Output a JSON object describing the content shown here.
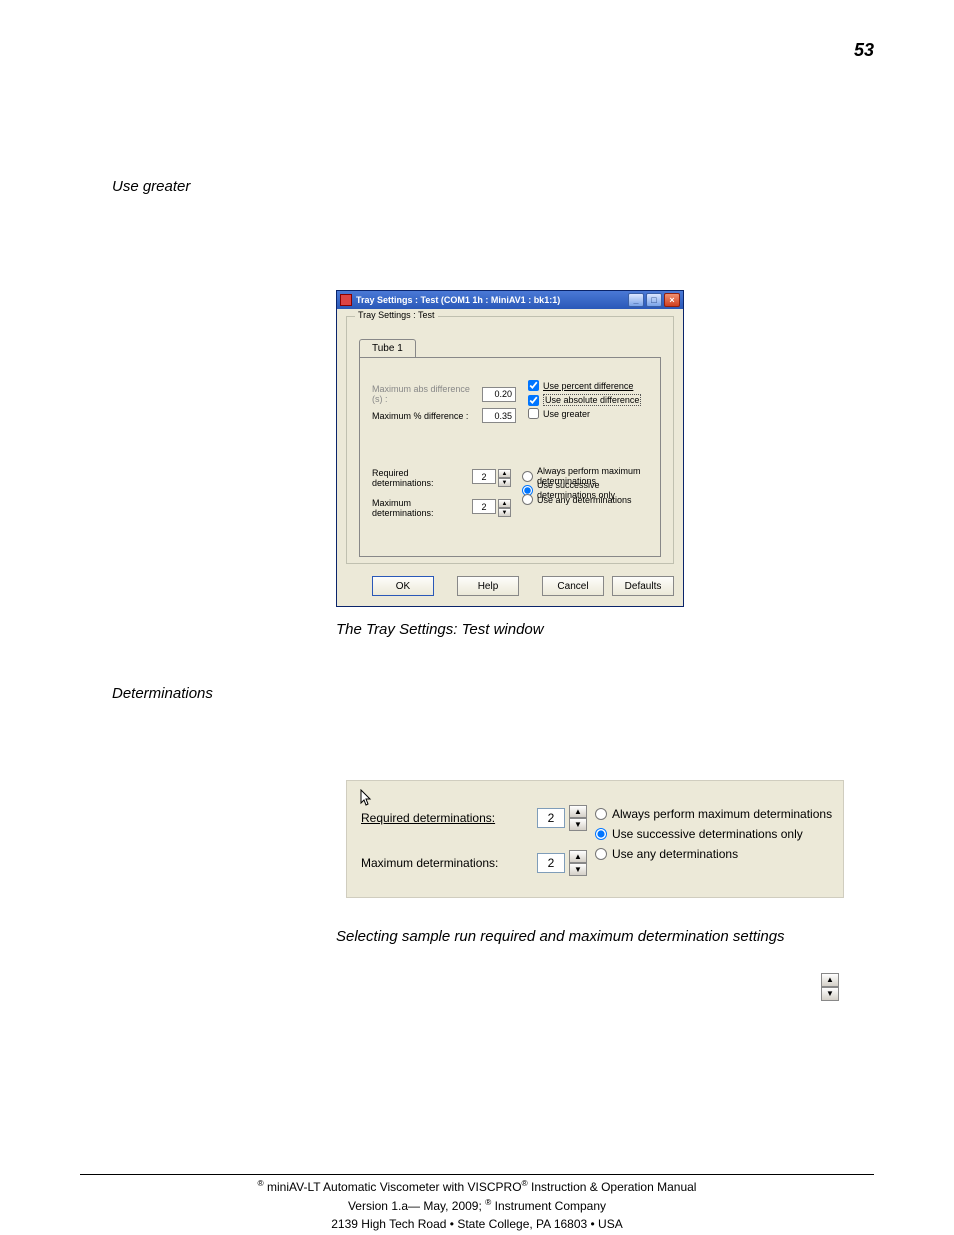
{
  "page_number": "53",
  "headings": {
    "use_greater": "Use greater",
    "determinations": "Determinations"
  },
  "captions": {
    "tray": "The Tray Settings: Test window",
    "determ": "Selecting sample run required and maximum determination settings"
  },
  "dialog": {
    "title": "Tray Settings : Test (COM1 1h : MiniAV1 : bk1:1)",
    "min_icon": "_",
    "max_icon": "□",
    "close_icon": "×",
    "groupbox_title": "Tray Settings : Test",
    "tab_label": "Tube 1",
    "row_abs_label": "Maximum abs difference (s) :",
    "row_abs_value": "0.20",
    "row_pct_label": "Maximum % difference :",
    "row_pct_value": "0.35",
    "chk_percent": "Use percent difference",
    "chk_absolute": "Use absolute difference",
    "chk_greater": "Use greater",
    "req_label": "Required determinations:",
    "req_value": "2",
    "max_label": "Maximum determinations:",
    "max_value": "2",
    "rad_always": "Always perform maximum determinations",
    "rad_successive": "Use successive determinations only",
    "rad_any": "Use any determinations",
    "btn_ok": "OK",
    "btn_help": "Help",
    "btn_cancel": "Cancel",
    "btn_defaults": "Defaults"
  },
  "determ_panel": {
    "req_label": "Required determinations:",
    "req_value": "2",
    "max_label": "Maximum determinations:",
    "max_value": "2",
    "rad_always": "Always perform maximum determinations",
    "rad_successive": "Use successive determinations only",
    "rad_any": "Use any determinations"
  },
  "spin_glyphs": {
    "up": "▲",
    "down": "▼"
  },
  "footer": {
    "line1a": " miniAV-LT Automatic Viscometer with VISCPRO",
    "line1b": " Instruction & Operation Manual",
    "line2a": "Version 1.a— May, 2009; ",
    "line2b": " Instrument Company",
    "line3": "2139 High Tech Road • State College, PA  16803 • USA",
    "reg": "®"
  }
}
